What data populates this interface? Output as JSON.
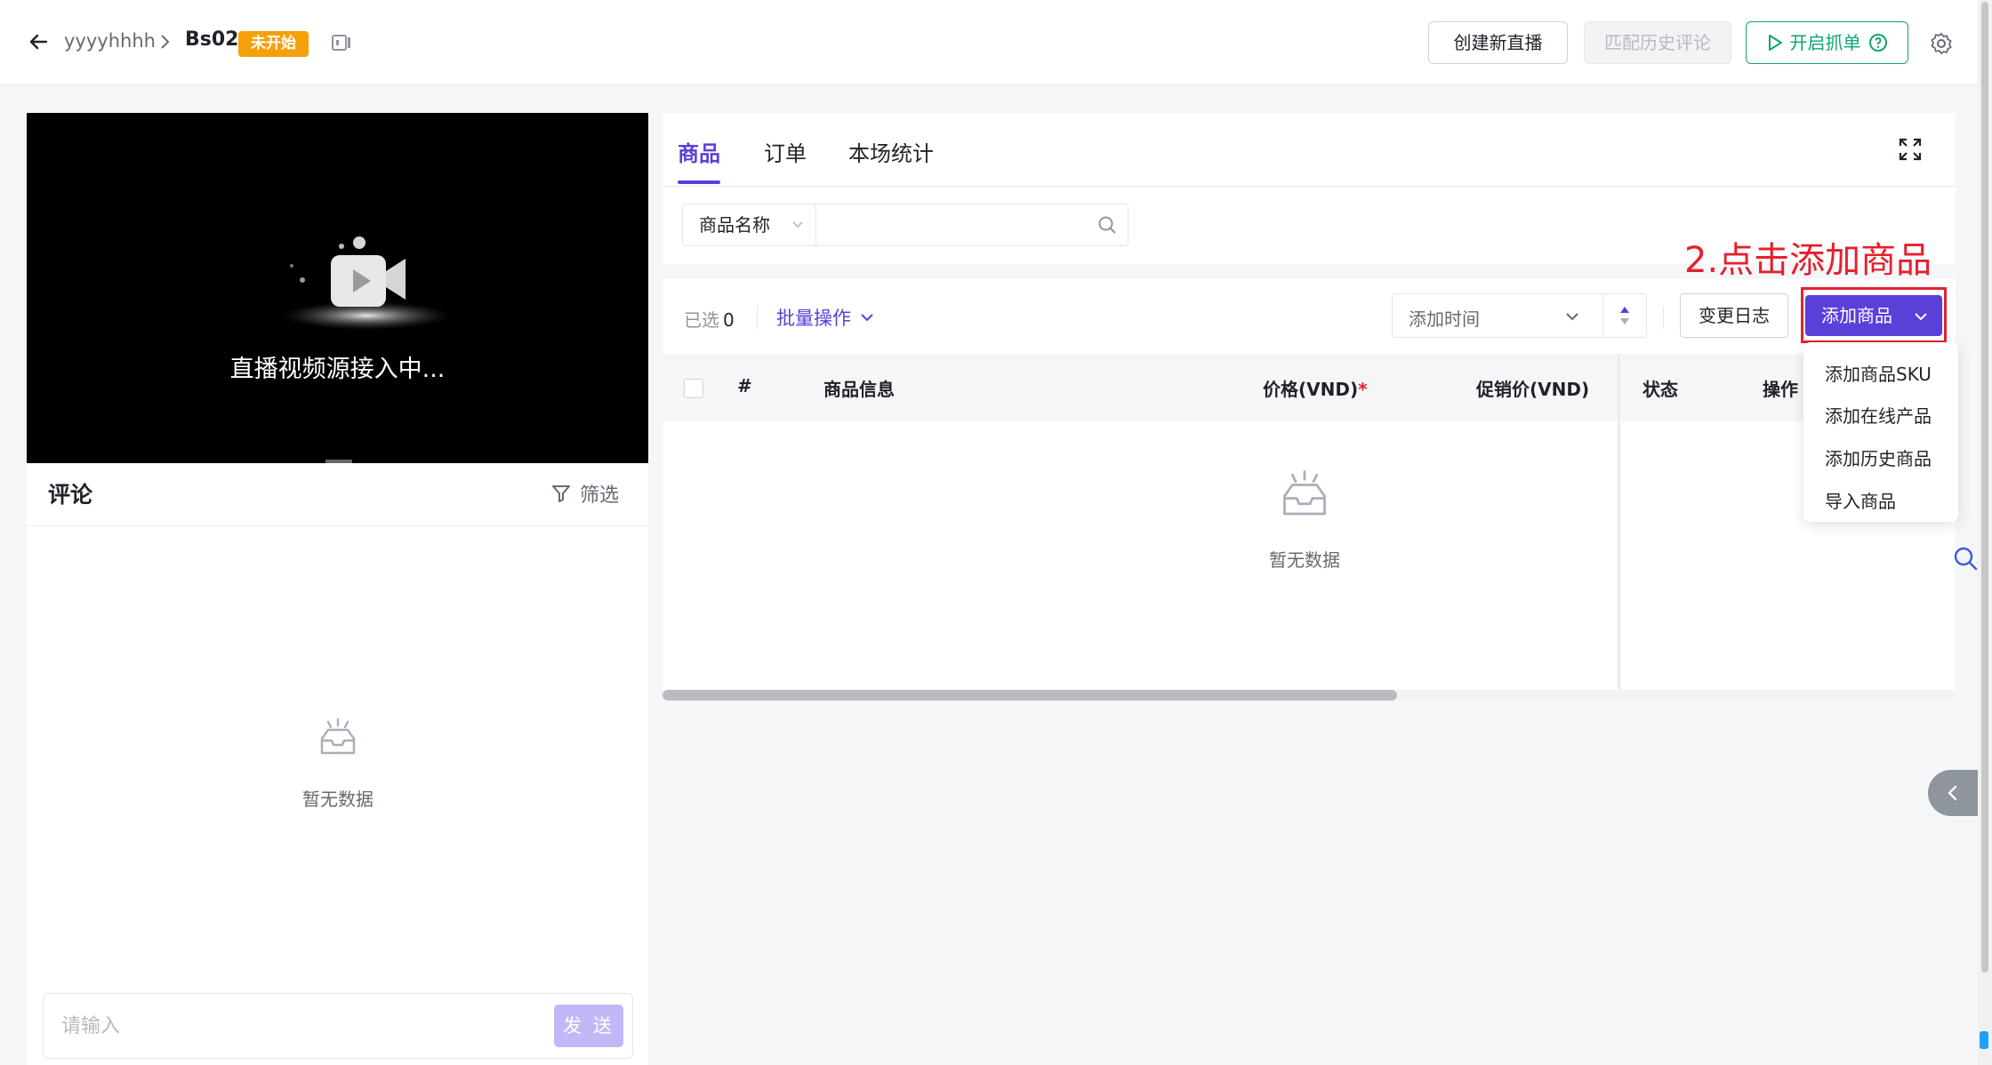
{
  "header": {
    "breadcrumb_root": "yyyyhhhh",
    "breadcrumb_current": "Bs02",
    "status_badge": "未开始",
    "create_live_label": "创建新直播",
    "match_history_label": "匹配历史评论",
    "start_grab_label": "开启抓单"
  },
  "video": {
    "status_text": "直播视频源接入中..."
  },
  "comments": {
    "title": "评论",
    "filter_label": "筛选",
    "empty_text": "暂无数据",
    "input_placeholder": "请输入",
    "send_label": "发 送"
  },
  "products_panel": {
    "tabs": [
      {
        "label": "商品",
        "active": true
      },
      {
        "label": "订单",
        "active": false
      },
      {
        "label": "本场统计",
        "active": false
      }
    ],
    "search_field_select": "商品名称",
    "search_value": "",
    "selected_label": "已选",
    "selected_count": "0",
    "batch_label": "批量操作",
    "sort_label": "添加时间",
    "change_log_label": "变更日志",
    "add_product_label": "添加商品",
    "annotation": "2.点击添加商品",
    "table_headers": {
      "index": "#",
      "info": "商品信息",
      "price": "价格(VND)",
      "price_required": "*",
      "promo_price": "促销价(VND)",
      "status": "状态",
      "actions": "操作"
    },
    "empty_text": "暂无数据",
    "add_menu": [
      "添加商品SKU",
      "添加在线产品",
      "添加历史商品",
      "导入商品"
    ]
  },
  "colors": {
    "accent": "#5b3fd9",
    "warning": "#f5a00a",
    "success": "#10a374",
    "annotation": "#e5202e"
  }
}
